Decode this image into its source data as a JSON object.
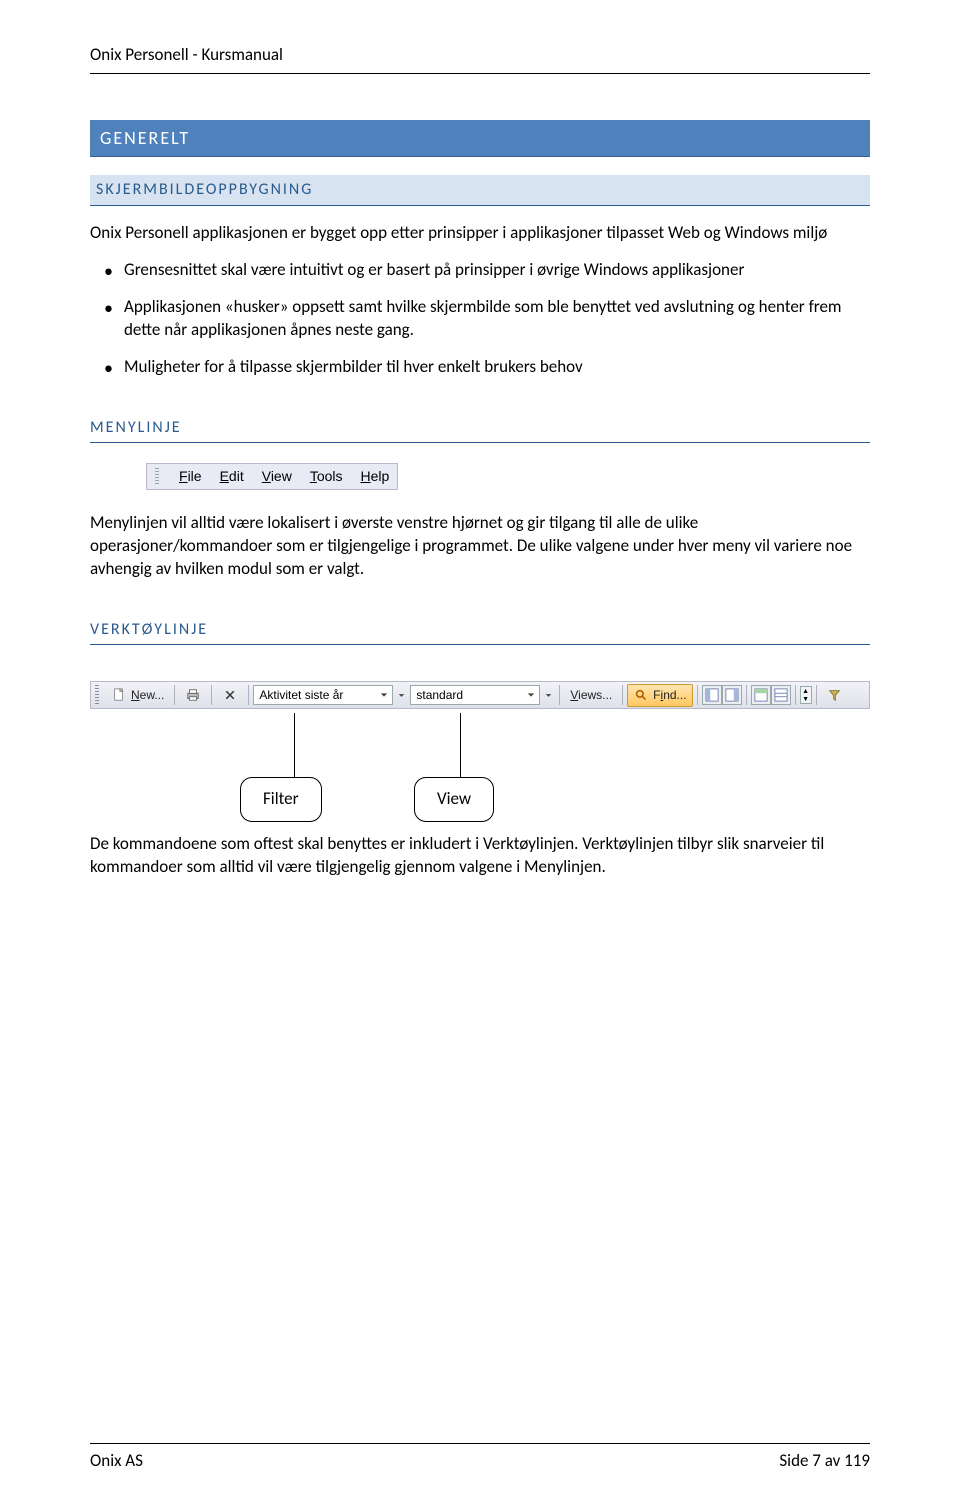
{
  "header": {
    "title": "Onix Personell - Kursmanual"
  },
  "sections": {
    "h1": "GENERELT",
    "h2": "SKJERMBILDEOPPBYGNING",
    "intro": "Onix Personell applikasjonen er bygget opp etter prinsipper i applikasjoner tilpasset Web og Windows miljø",
    "bullets": [
      "Grensesnittet skal være intuitivt og er basert på prinsipper i øvrige Windows applikasjoner",
      "Applikasjonen «husker» oppsett samt hvilke skjermbilde som ble benyttet ved avslutning og henter frem dette når applikasjonen åpnes neste gang.",
      "Muligheter for å tilpasse skjermbilder til hver enkelt brukers behov"
    ],
    "menylinje_h": "MENYLINJE",
    "menylinje_text": "Menylinjen vil alltid være lokalisert i øverste venstre hjørnet og gir tilgang til alle de ulike operasjoner/kommandoer som er tilgjengelige i programmet. De ulike valgene under hver meny vil variere noe avhengig av hvilken modul som er valgt.",
    "verktoylinje_h": "VERKTØYLINJE",
    "verktoylinje_text1": "De kommandoene som oftest skal benyttes er inkludert i Verktøylinjen. Verktøylinjen tilbyr slik snarveier til kommandoer som alltid vil være tilgjengelig gjennom valgene i Menylinjen."
  },
  "menubar": {
    "items": [
      "File",
      "Edit",
      "View",
      "Tools",
      "Help"
    ]
  },
  "toolbar": {
    "new_label": "New...",
    "combo1": "Aktivitet siste år",
    "combo2": "standard",
    "views_label": "Views...",
    "find_label": "Find..."
  },
  "callouts": {
    "filter": "Filter",
    "view": "View"
  },
  "footer": {
    "left": "Onix AS",
    "right": "Side 7 av 119"
  }
}
